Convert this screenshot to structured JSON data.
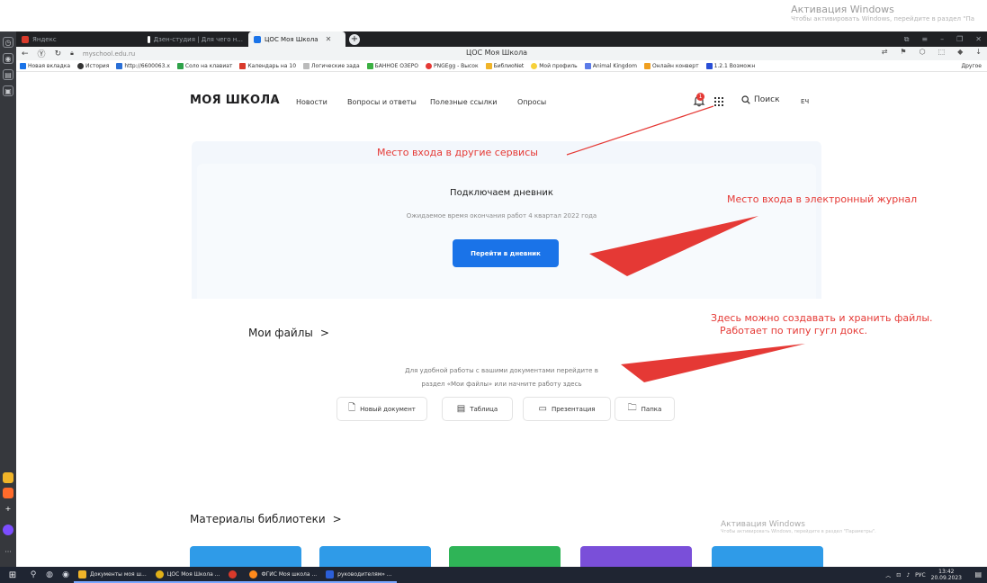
{
  "windows_activation": {
    "title": "Активация Windows",
    "subtitle": "Чтобы активировать Windows, перейдите в раздел \"Па",
    "bottom_title": "Активация Windows",
    "bottom_subtitle": "Чтобы активировать Windows, перейдите в раздел \"Параметры\"."
  },
  "browser": {
    "tabs": [
      {
        "label": "Яндекс",
        "active": false
      },
      {
        "label": "Дзен-студия | Для чего н...",
        "active": false
      },
      {
        "label": "ЦОС Моя Школа",
        "active": true
      }
    ],
    "url": "myschool.edu.ru",
    "page_title": "ЦОС Моя Школа",
    "bookmarks": [
      "Новая вкладка",
      "История",
      "http://6600063.x",
      "Соло на клавиат",
      "Календарь на 10",
      "Логические зада",
      "БАННОЕ ОЗЕРО",
      "PNGEgg - Высок",
      "БиблиоNet",
      "Мой профиль",
      "Animal Kingdom",
      "Онлайн конверт",
      "1.2.1 Возможн"
    ],
    "bookmarks_other": "Другое"
  },
  "site": {
    "logo": "МОЯ ШКОЛА",
    "beta": "β",
    "nav": [
      "Новости",
      "Вопросы и ответы",
      "Полезные ссылки",
      "Опросы"
    ],
    "notification_count": "1",
    "search_label": "Поиск",
    "user_initials": "ЕЧ",
    "diary": {
      "title": "Подключаем дневник",
      "subtitle": "Ожидаемое время окончания работ 4 квартал 2022 года",
      "button_label": "Перейти в дневник"
    },
    "files": {
      "title": "Мои файлы",
      "chevron": ">",
      "desc_line1": "Для удобной работы с вашими документами перейдите в",
      "desc_line2": "раздел «Мои файлы» или начните работу здесь",
      "actions": [
        {
          "label": "Новый документ",
          "icon": "document-icon"
        },
        {
          "label": "Таблица",
          "icon": "table-icon"
        },
        {
          "label": "Презентация",
          "icon": "presentation-icon"
        },
        {
          "label": "Папка",
          "icon": "folder-icon"
        }
      ]
    },
    "library": {
      "title": "Материалы библиотеки",
      "chevron": ">",
      "card_colors": [
        "#2f9be8",
        "#2f9be8",
        "#2fb457",
        "#7a4fd9",
        "#2f9be8"
      ]
    }
  },
  "annotations": {
    "services": "Место входа в другие сервисы",
    "journal": "Место входа в электронный журнал",
    "files_line1": "Здесь можно создавать и хранить файлы.",
    "files_line2": "Работает по типу гугл докс."
  },
  "taskbar": {
    "items": [
      {
        "label": "Документы моя ш...",
        "color": "#f0b429"
      },
      {
        "label": "ЦОС Моя Школа ...",
        "color": "#e0b018"
      },
      {
        "label": "",
        "color": "#d93a2b"
      },
      {
        "label": "ФГИС Моя школа ...",
        "color": "#ff8a1c"
      },
      {
        "label": "руководителям» ...",
        "color": "#2b5fd8"
      }
    ],
    "lang": "РУС",
    "time": "13:42",
    "date": "20.09.2023"
  },
  "colors": {
    "accent_blue": "#1a73e8",
    "annotation_red": "#e53935",
    "notification_red": "#e53935"
  }
}
